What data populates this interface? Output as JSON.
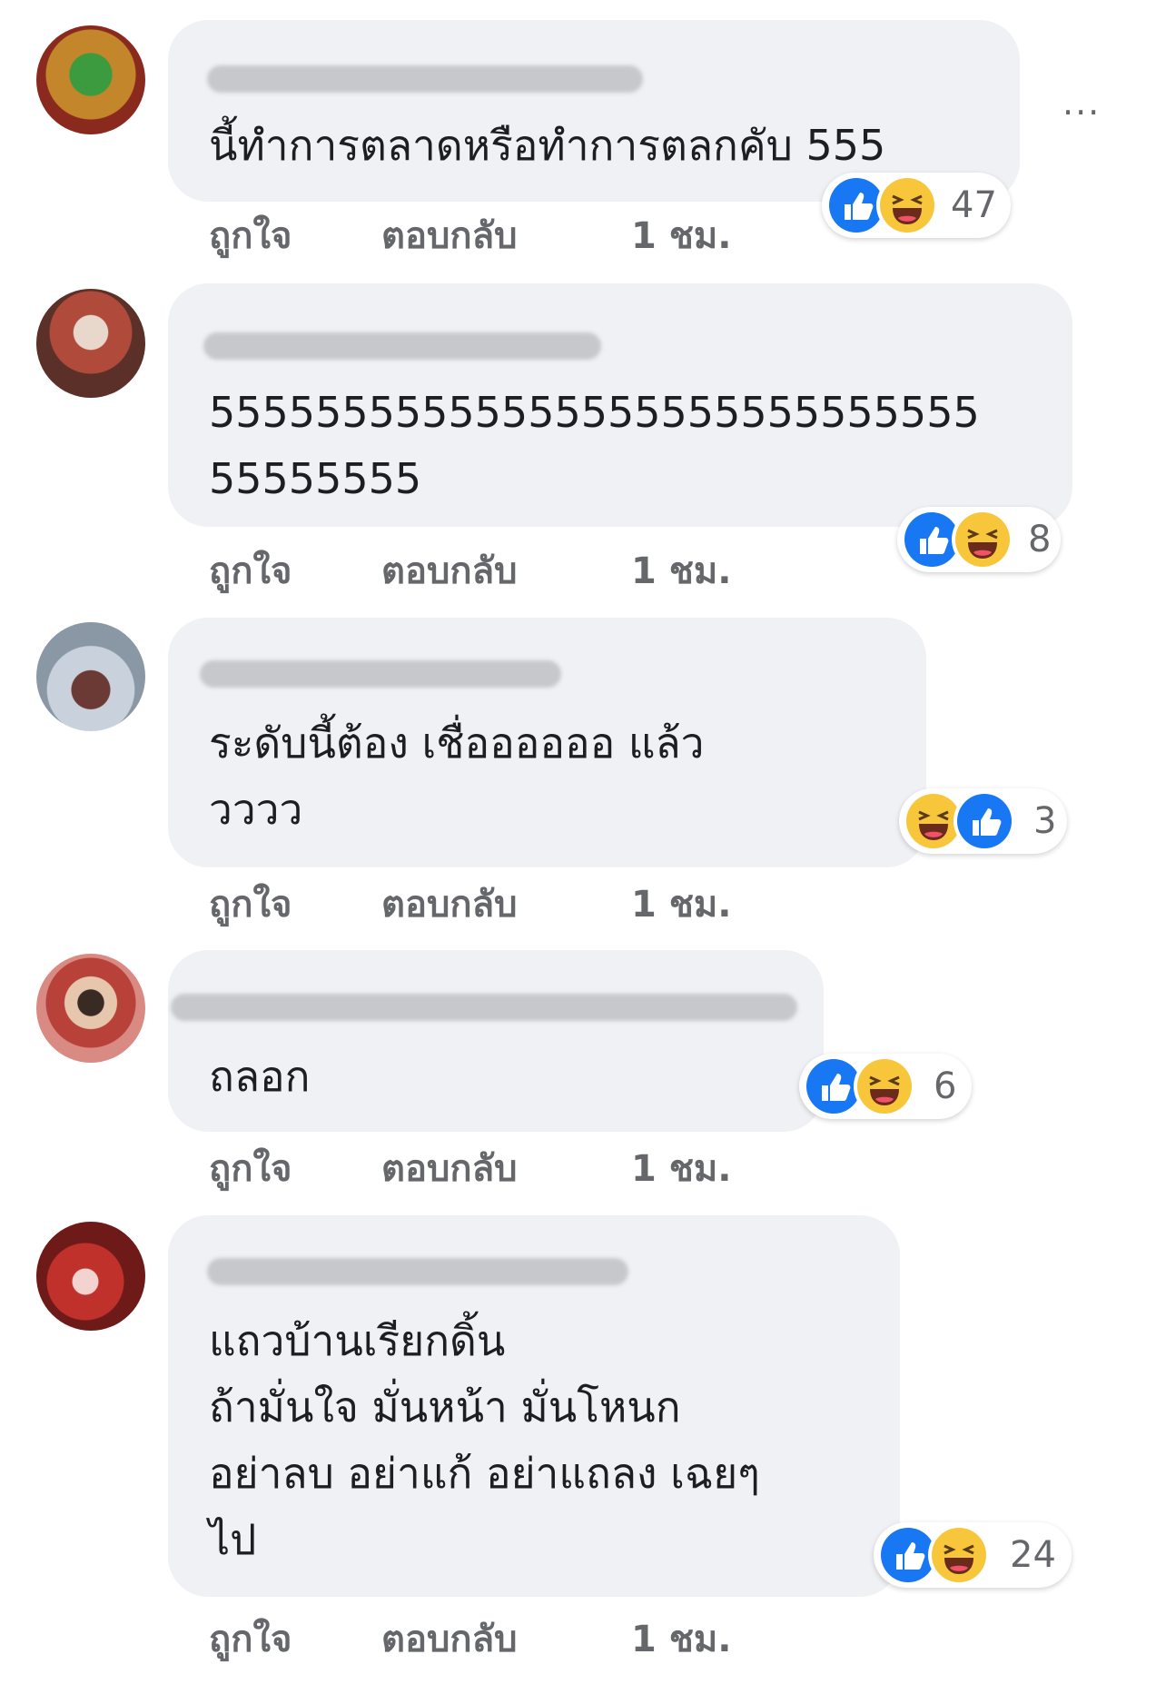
{
  "comments": [
    {
      "text": "นี้ทำการตลาดหรือทำการตลกคับ 555",
      "reaction_count": "47",
      "reactions": [
        "like-icon",
        "haha-icon"
      ],
      "actions": {
        "like": "ถูกใจ",
        "reply": "ตอบกลับ",
        "time": "1 ชม."
      }
    },
    {
      "text": "55555555555555555555555555555\n55555555",
      "reaction_count": "8",
      "reactions": [
        "like-icon",
        "haha-icon"
      ],
      "actions": {
        "like": "ถูกใจ",
        "reply": "ตอบกลับ",
        "time": "1 ชม."
      }
    },
    {
      "text": "ระดับนี้ต้อง เชื่ออออออ แล้ว\nวววว",
      "reaction_count": "3",
      "reactions": [
        "haha-icon",
        "like-icon"
      ],
      "actions": {
        "like": "ถูกใจ",
        "reply": "ตอบกลับ",
        "time": "1 ชม."
      }
    },
    {
      "text": "ถลอก",
      "reaction_count": "6",
      "reactions": [
        "like-icon",
        "haha-icon"
      ],
      "actions": {
        "like": "ถูกใจ",
        "reply": "ตอบกลับ",
        "time": "1 ชม."
      }
    },
    {
      "text": "แถวบ้านเรียกดิ้น\nถ้ามั่นใจ มั่นหน้า มั่นโหนก\nอย่าลบ อย่าแก้ อย่าแถลง เฉยๆ\nไป",
      "reaction_count": "24",
      "reactions": [
        "like-icon",
        "haha-icon"
      ],
      "actions": {
        "like": "ถูกใจ",
        "reply": "ตอบกลับ",
        "time": "1 ชม."
      }
    }
  ],
  "more_label": "···",
  "colors": {
    "like": "#1877f2",
    "haha": "#f7c63b",
    "bubble": "#eff1f4",
    "meta": "#65676b"
  }
}
